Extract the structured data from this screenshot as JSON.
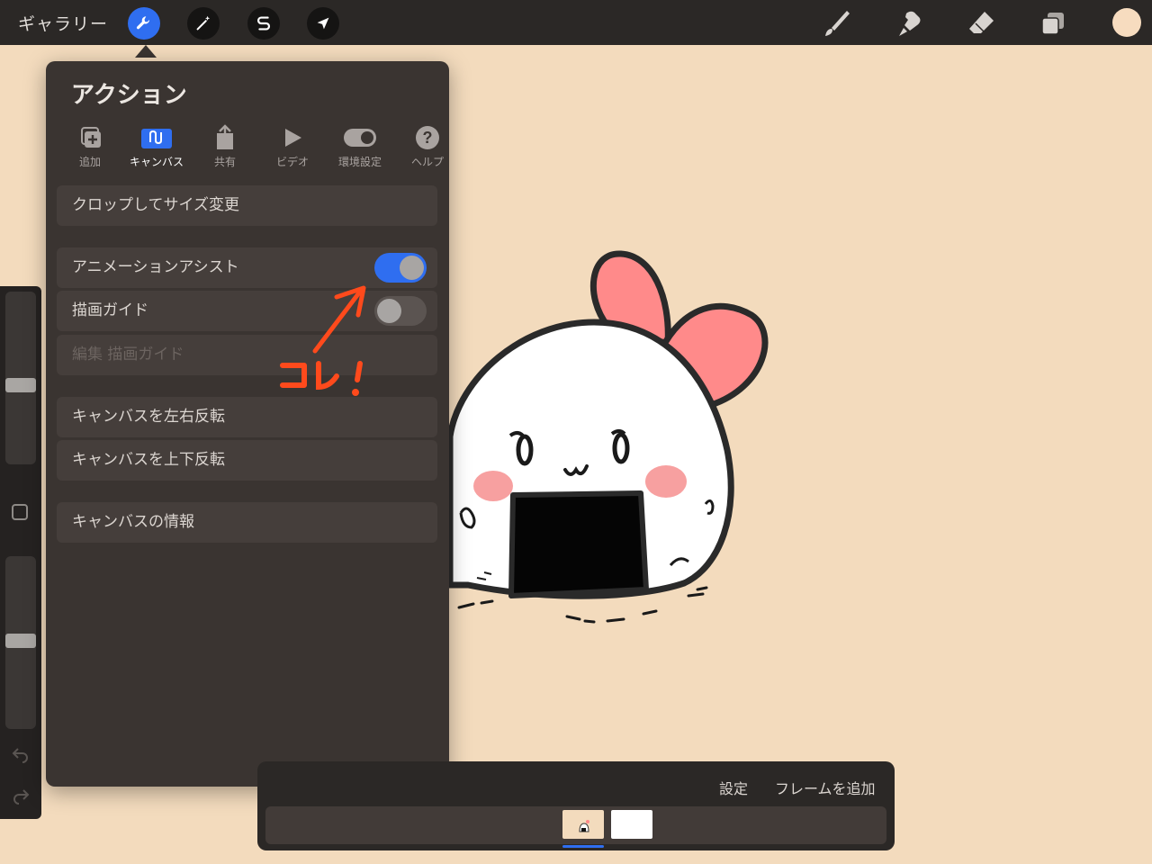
{
  "toolbar": {
    "gallery_label": "ギャラリー"
  },
  "popover": {
    "title": "アクション",
    "tabs": [
      {
        "label": "追加",
        "icon": "add-icon"
      },
      {
        "label": "キャンバス",
        "icon": "canvas-icon"
      },
      {
        "label": "共有",
        "icon": "share-icon"
      },
      {
        "label": "ビデオ",
        "icon": "play-icon"
      },
      {
        "label": "環境設定",
        "icon": "toggle-icon"
      },
      {
        "label": "ヘルプ",
        "icon": "help-icon"
      }
    ],
    "active_tab": "キャンバス",
    "rows": {
      "crop": "クロップしてサイズ変更",
      "animation_assist": "アニメーションアシスト",
      "drawing_guide": "描画ガイド",
      "edit_drawing_guide": "編集 描画ガイド",
      "flip_horizontal": "キャンバスを左右反転",
      "flip_vertical": "キャンバスを上下反転",
      "canvas_info": "キャンバスの情報"
    },
    "toggles": {
      "animation_assist_on": true,
      "drawing_guide_on": false
    }
  },
  "timeline": {
    "settings_label": "設定",
    "add_frame_label": "フレームを追加"
  },
  "colors": {
    "accent": "#2f6ef0",
    "canvas": "#f3dbbd",
    "annotation": "#ff4a1c",
    "current_color": "#f7dcbf"
  }
}
